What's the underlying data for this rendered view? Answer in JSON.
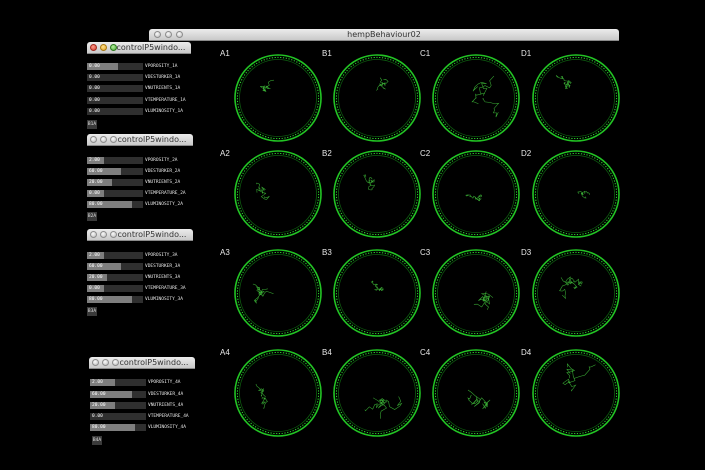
{
  "main_window": {
    "title": "hempBehaviour02"
  },
  "control_panels": [
    {
      "title": "controlP5windo...",
      "button_label": "B1A",
      "sliders": [
        {
          "value": "0.00",
          "label": "VPOROSITY_1A",
          "fill": 0.55
        },
        {
          "value": "0.00",
          "label": "VDESTURKER_1A",
          "fill": 0.0
        },
        {
          "value": "0.00",
          "label": "VNUTRIENTS_1A",
          "fill": 0.0
        },
        {
          "value": "0.00",
          "label": "VTEMPERATURE_1A",
          "fill": 0.0
        },
        {
          "value": "0.00",
          "label": "VLUMINOSITY_1A",
          "fill": 0.0
        }
      ]
    },
    {
      "title": "controlP5windo...",
      "button_label": "B2A",
      "sliders": [
        {
          "value": "2.00",
          "label": "VPOROSITY_2A",
          "fill": 0.3
        },
        {
          "value": "60.00",
          "label": "VDESTURKER_2A",
          "fill": 0.6
        },
        {
          "value": "20.00",
          "label": "VNUTRIENTS_2A",
          "fill": 0.45
        },
        {
          "value": "0.00",
          "label": "VTEMPERATURE_2A",
          "fill": 0.3
        },
        {
          "value": "80.00",
          "label": "VLUMINOSITY_2A",
          "fill": 0.8
        }
      ]
    },
    {
      "title": "controlP5windo...",
      "button_label": "B3A",
      "sliders": [
        {
          "value": "2.00",
          "label": "VPOROSITY_3A",
          "fill": 0.3
        },
        {
          "value": "60.00",
          "label": "VDESTURKER_3A",
          "fill": 0.6
        },
        {
          "value": "20.00",
          "label": "VNUTRIENTS_3A",
          "fill": 0.35
        },
        {
          "value": "0.00",
          "label": "VTEMPERATURE_3A",
          "fill": 0.3
        },
        {
          "value": "80.00",
          "label": "VLUMINOSITY_3A",
          "fill": 0.8
        }
      ]
    },
    {
      "title": "controlP5windo...",
      "button_label": "B4A",
      "sliders": [
        {
          "value": "2.00",
          "label": "VPOROSITY_4A",
          "fill": 0.45
        },
        {
          "value": "60.00",
          "label": "VDESTURKER_4A",
          "fill": 0.75
        },
        {
          "value": "20.00",
          "label": "VNUTRIENTS_4A",
          "fill": 0.45
        },
        {
          "value": "0.00",
          "label": "VTEMPERATURE_4A",
          "fill": 0.0
        },
        {
          "value": "80.00",
          "label": "VLUMINOSITY_4A",
          "fill": 0.8
        }
      ]
    }
  ],
  "wells": [
    {
      "label": "A1"
    },
    {
      "label": "B1"
    },
    {
      "label": "C1"
    },
    {
      "label": "D1"
    },
    {
      "label": "A2"
    },
    {
      "label": "B2"
    },
    {
      "label": "C2"
    },
    {
      "label": "D2"
    },
    {
      "label": "A3"
    },
    {
      "label": "B3"
    },
    {
      "label": "C3"
    },
    {
      "label": "D3"
    },
    {
      "label": "A4"
    },
    {
      "label": "B4"
    },
    {
      "label": "C4"
    },
    {
      "label": "D4"
    }
  ],
  "colors": {
    "dish_ring": "#22c424",
    "track": "#3fbf3a",
    "background": "#000000"
  }
}
